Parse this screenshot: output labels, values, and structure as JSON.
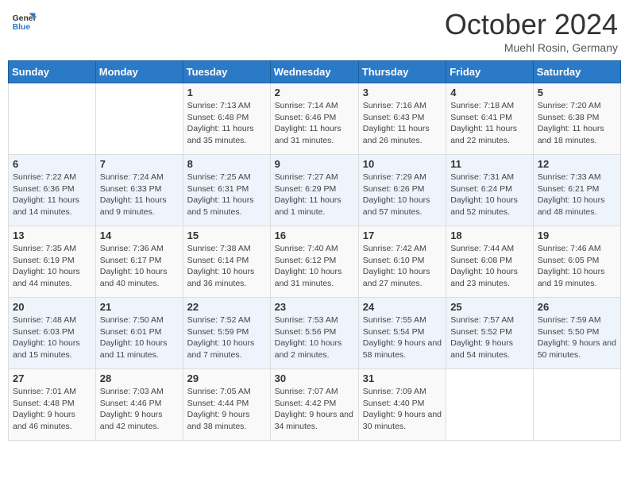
{
  "header": {
    "logo_line1": "General",
    "logo_line2": "Blue",
    "month_title": "October 2024",
    "location": "Muehl Rosin, Germany"
  },
  "weekdays": [
    "Sunday",
    "Monday",
    "Tuesday",
    "Wednesday",
    "Thursday",
    "Friday",
    "Saturday"
  ],
  "weeks": [
    [
      {
        "day": "",
        "sunrise": "",
        "sunset": "",
        "daylight": ""
      },
      {
        "day": "",
        "sunrise": "",
        "sunset": "",
        "daylight": ""
      },
      {
        "day": "1",
        "sunrise": "Sunrise: 7:13 AM",
        "sunset": "Sunset: 6:48 PM",
        "daylight": "Daylight: 11 hours and 35 minutes."
      },
      {
        "day": "2",
        "sunrise": "Sunrise: 7:14 AM",
        "sunset": "Sunset: 6:46 PM",
        "daylight": "Daylight: 11 hours and 31 minutes."
      },
      {
        "day": "3",
        "sunrise": "Sunrise: 7:16 AM",
        "sunset": "Sunset: 6:43 PM",
        "daylight": "Daylight: 11 hours and 26 minutes."
      },
      {
        "day": "4",
        "sunrise": "Sunrise: 7:18 AM",
        "sunset": "Sunset: 6:41 PM",
        "daylight": "Daylight: 11 hours and 22 minutes."
      },
      {
        "day": "5",
        "sunrise": "Sunrise: 7:20 AM",
        "sunset": "Sunset: 6:38 PM",
        "daylight": "Daylight: 11 hours and 18 minutes."
      }
    ],
    [
      {
        "day": "6",
        "sunrise": "Sunrise: 7:22 AM",
        "sunset": "Sunset: 6:36 PM",
        "daylight": "Daylight: 11 hours and 14 minutes."
      },
      {
        "day": "7",
        "sunrise": "Sunrise: 7:24 AM",
        "sunset": "Sunset: 6:33 PM",
        "daylight": "Daylight: 11 hours and 9 minutes."
      },
      {
        "day": "8",
        "sunrise": "Sunrise: 7:25 AM",
        "sunset": "Sunset: 6:31 PM",
        "daylight": "Daylight: 11 hours and 5 minutes."
      },
      {
        "day": "9",
        "sunrise": "Sunrise: 7:27 AM",
        "sunset": "Sunset: 6:29 PM",
        "daylight": "Daylight: 11 hours and 1 minute."
      },
      {
        "day": "10",
        "sunrise": "Sunrise: 7:29 AM",
        "sunset": "Sunset: 6:26 PM",
        "daylight": "Daylight: 10 hours and 57 minutes."
      },
      {
        "day": "11",
        "sunrise": "Sunrise: 7:31 AM",
        "sunset": "Sunset: 6:24 PM",
        "daylight": "Daylight: 10 hours and 52 minutes."
      },
      {
        "day": "12",
        "sunrise": "Sunrise: 7:33 AM",
        "sunset": "Sunset: 6:21 PM",
        "daylight": "Daylight: 10 hours and 48 minutes."
      }
    ],
    [
      {
        "day": "13",
        "sunrise": "Sunrise: 7:35 AM",
        "sunset": "Sunset: 6:19 PM",
        "daylight": "Daylight: 10 hours and 44 minutes."
      },
      {
        "day": "14",
        "sunrise": "Sunrise: 7:36 AM",
        "sunset": "Sunset: 6:17 PM",
        "daylight": "Daylight: 10 hours and 40 minutes."
      },
      {
        "day": "15",
        "sunrise": "Sunrise: 7:38 AM",
        "sunset": "Sunset: 6:14 PM",
        "daylight": "Daylight: 10 hours and 36 minutes."
      },
      {
        "day": "16",
        "sunrise": "Sunrise: 7:40 AM",
        "sunset": "Sunset: 6:12 PM",
        "daylight": "Daylight: 10 hours and 31 minutes."
      },
      {
        "day": "17",
        "sunrise": "Sunrise: 7:42 AM",
        "sunset": "Sunset: 6:10 PM",
        "daylight": "Daylight: 10 hours and 27 minutes."
      },
      {
        "day": "18",
        "sunrise": "Sunrise: 7:44 AM",
        "sunset": "Sunset: 6:08 PM",
        "daylight": "Daylight: 10 hours and 23 minutes."
      },
      {
        "day": "19",
        "sunrise": "Sunrise: 7:46 AM",
        "sunset": "Sunset: 6:05 PM",
        "daylight": "Daylight: 10 hours and 19 minutes."
      }
    ],
    [
      {
        "day": "20",
        "sunrise": "Sunrise: 7:48 AM",
        "sunset": "Sunset: 6:03 PM",
        "daylight": "Daylight: 10 hours and 15 minutes."
      },
      {
        "day": "21",
        "sunrise": "Sunrise: 7:50 AM",
        "sunset": "Sunset: 6:01 PM",
        "daylight": "Daylight: 10 hours and 11 minutes."
      },
      {
        "day": "22",
        "sunrise": "Sunrise: 7:52 AM",
        "sunset": "Sunset: 5:59 PM",
        "daylight": "Daylight: 10 hours and 7 minutes."
      },
      {
        "day": "23",
        "sunrise": "Sunrise: 7:53 AM",
        "sunset": "Sunset: 5:56 PM",
        "daylight": "Daylight: 10 hours and 2 minutes."
      },
      {
        "day": "24",
        "sunrise": "Sunrise: 7:55 AM",
        "sunset": "Sunset: 5:54 PM",
        "daylight": "Daylight: 9 hours and 58 minutes."
      },
      {
        "day": "25",
        "sunrise": "Sunrise: 7:57 AM",
        "sunset": "Sunset: 5:52 PM",
        "daylight": "Daylight: 9 hours and 54 minutes."
      },
      {
        "day": "26",
        "sunrise": "Sunrise: 7:59 AM",
        "sunset": "Sunset: 5:50 PM",
        "daylight": "Daylight: 9 hours and 50 minutes."
      }
    ],
    [
      {
        "day": "27",
        "sunrise": "Sunrise: 7:01 AM",
        "sunset": "Sunset: 4:48 PM",
        "daylight": "Daylight: 9 hours and 46 minutes."
      },
      {
        "day": "28",
        "sunrise": "Sunrise: 7:03 AM",
        "sunset": "Sunset: 4:46 PM",
        "daylight": "Daylight: 9 hours and 42 minutes."
      },
      {
        "day": "29",
        "sunrise": "Sunrise: 7:05 AM",
        "sunset": "Sunset: 4:44 PM",
        "daylight": "Daylight: 9 hours and 38 minutes."
      },
      {
        "day": "30",
        "sunrise": "Sunrise: 7:07 AM",
        "sunset": "Sunset: 4:42 PM",
        "daylight": "Daylight: 9 hours and 34 minutes."
      },
      {
        "day": "31",
        "sunrise": "Sunrise: 7:09 AM",
        "sunset": "Sunset: 4:40 PM",
        "daylight": "Daylight: 9 hours and 30 minutes."
      },
      {
        "day": "",
        "sunrise": "",
        "sunset": "",
        "daylight": ""
      },
      {
        "day": "",
        "sunrise": "",
        "sunset": "",
        "daylight": ""
      }
    ]
  ]
}
